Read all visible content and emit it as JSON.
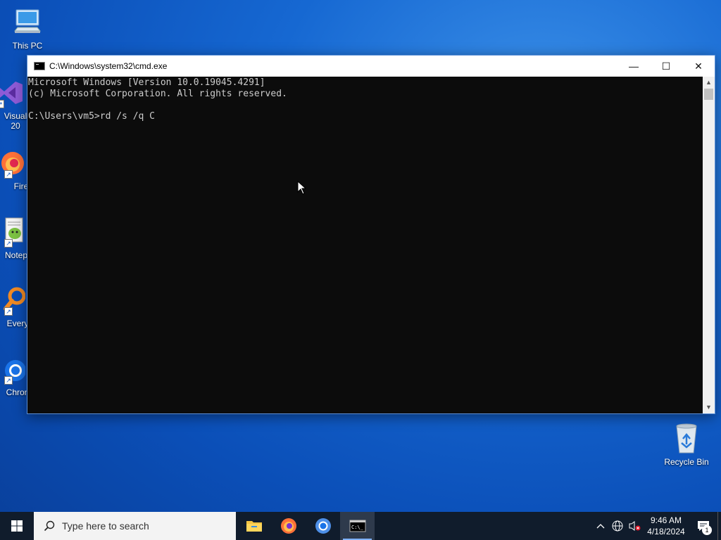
{
  "desktop": {
    "icons": [
      {
        "label": "This PC"
      },
      {
        "label": "Visual 20"
      },
      {
        "label": "Fire"
      },
      {
        "label": "Notep"
      },
      {
        "label": "Every"
      },
      {
        "label": "Chron"
      },
      {
        "label": "Recycle Bin"
      }
    ]
  },
  "window": {
    "title": "C:\\Windows\\system32\\cmd.exe",
    "minimize_symbol": "—",
    "maximize_symbol": "☐",
    "close_symbol": "✕"
  },
  "console": {
    "lines": [
      "Microsoft Windows [Version 10.0.19045.4291]",
      "(c) Microsoft Corporation. All rights reserved.",
      "",
      "C:\\Users\\vm5>rd /s /q C"
    ]
  },
  "taskbar": {
    "search_placeholder": "Type here to search",
    "apps": [
      "file-explorer",
      "firefox",
      "chrome",
      "command-prompt"
    ],
    "active_app": "command-prompt"
  },
  "tray": {
    "time": "9:46 AM",
    "date": "4/18/2024",
    "notification_count": "1"
  },
  "colors": {
    "console_bg": "#0c0c0c",
    "console_fg": "#cccccc",
    "taskbar_bg": "#101c2c"
  }
}
